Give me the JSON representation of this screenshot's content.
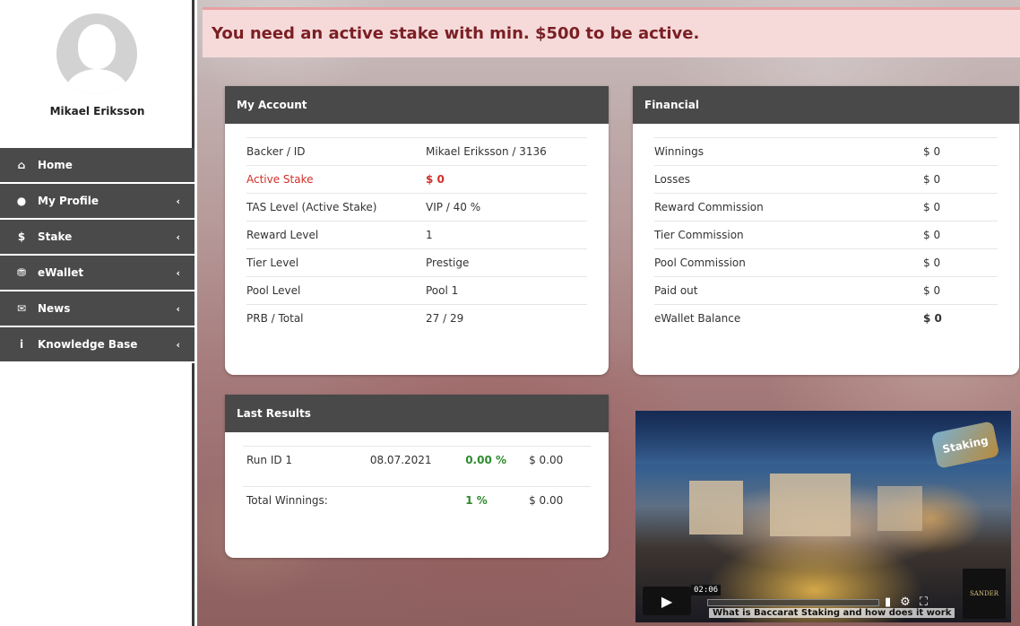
{
  "user": {
    "name": "Mikael Eriksson"
  },
  "nav": [
    {
      "label": "Home",
      "icon": "home-icon",
      "glyph": "⌂",
      "has_submenu": false
    },
    {
      "label": "My Profile",
      "icon": "user-icon",
      "glyph": "●",
      "has_submenu": true
    },
    {
      "label": "Stake",
      "icon": "dollar-icon",
      "glyph": "$",
      "has_submenu": true
    },
    {
      "label": "eWallet",
      "icon": "wallet-icon",
      "glyph": "⛃",
      "has_submenu": true
    },
    {
      "label": "News",
      "icon": "envelope-icon",
      "glyph": "✉",
      "has_submenu": true
    },
    {
      "label": "Knowledge Base",
      "icon": "info-icon",
      "glyph": "i",
      "has_submenu": true
    }
  ],
  "alert": {
    "text": "You need an active stake with min. $500 to be active."
  },
  "account": {
    "title": "My Account",
    "rows": [
      {
        "label": "Backer / ID",
        "value": "Mikael Eriksson / 3136"
      },
      {
        "label": "Active Stake",
        "value": "$ 0"
      },
      {
        "label": "TAS Level (Active Stake)",
        "value": "VIP / 40 %"
      },
      {
        "label": "Reward Level",
        "value": "1"
      },
      {
        "label": "Tier Level",
        "value": "Prestige"
      },
      {
        "label": "Pool Level",
        "value": "Pool 1"
      },
      {
        "label": "PRB / Total",
        "value": "27 / 29"
      }
    ]
  },
  "financial": {
    "title": "Financial",
    "rows": [
      {
        "label": "Winnings",
        "value": "$ 0"
      },
      {
        "label": "Losses",
        "value": "$ 0"
      },
      {
        "label": "Reward Commission",
        "value": "$ 0"
      },
      {
        "label": "Tier Commission",
        "value": "$ 0"
      },
      {
        "label": "Pool Commission",
        "value": "$ 0"
      },
      {
        "label": "Paid out",
        "value": "$ 0"
      },
      {
        "label": "eWallet Balance",
        "value": "$ 0"
      }
    ]
  },
  "results": {
    "title": "Last Results",
    "run": {
      "id": "Run ID 1",
      "date": "08.07.2021",
      "percent": "0.00 %",
      "amount": "$ 0.00"
    },
    "total": {
      "label": "Total Winnings:",
      "percent": "1 %",
      "amount": "$ 0.00"
    }
  },
  "video": {
    "time": "02:06",
    "title": "What is Baccarat Staking and how does it work",
    "logo_text": "Staking",
    "brand": "SANDER"
  },
  "colors": {
    "sidebar_bg": "#4a4a4a",
    "panel_header": "#494949",
    "alert_bg": "#f6dada",
    "alert_text": "#7a1f24",
    "active_stake_red": "#d0302a",
    "positive_green": "#2e8a2e"
  }
}
